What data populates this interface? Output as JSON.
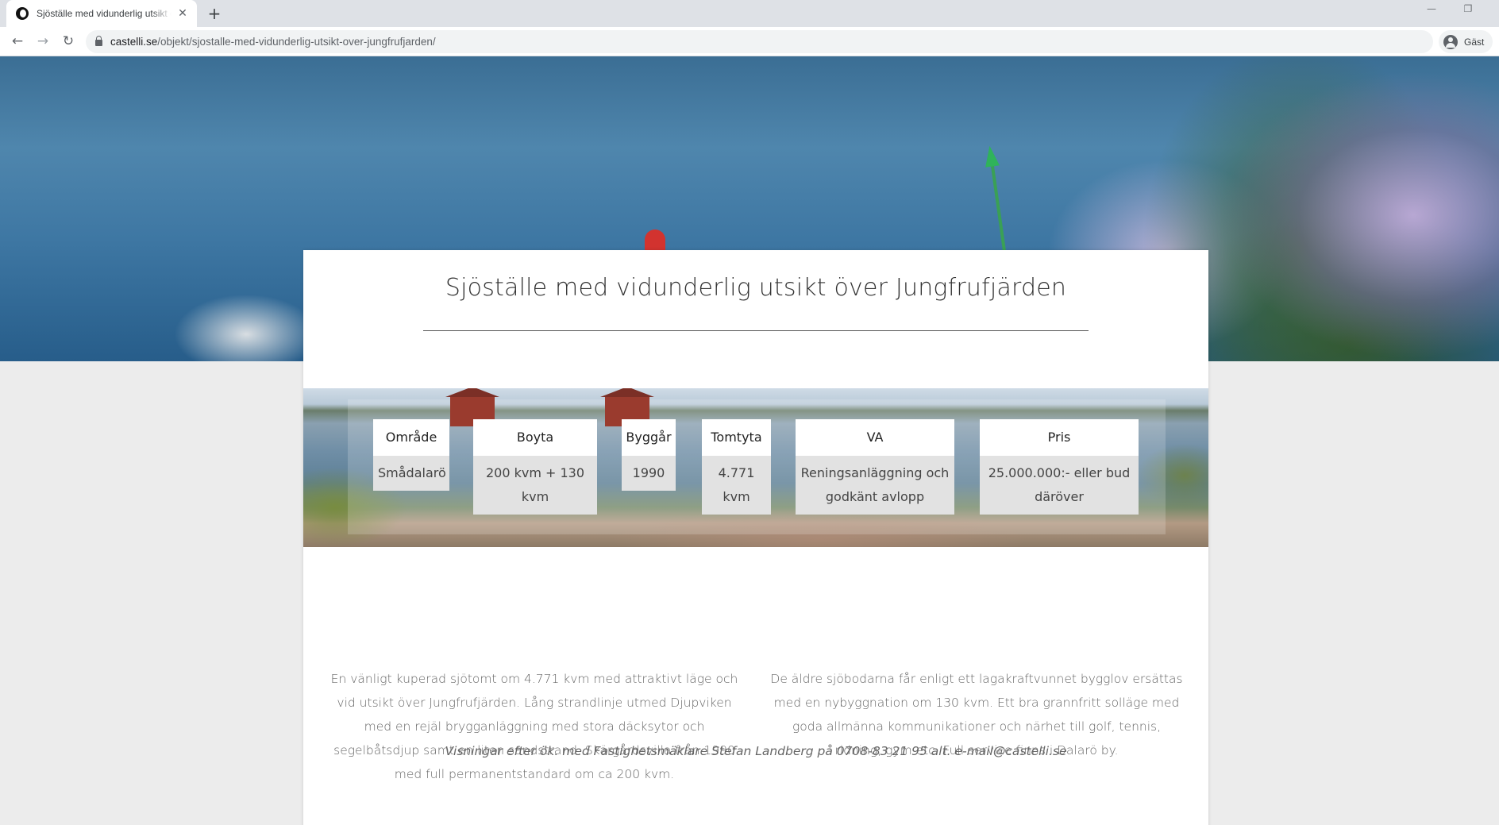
{
  "browser": {
    "tab_title": "Sjöställe med vidunderlig utsikt över Jungfrufjärden",
    "new_tab_glyph": "+",
    "close_glyph": "✕",
    "url_domain": "castelli.se",
    "url_path": "/objekt/sjostalle-med-vidunderlig-utsikt-over-jungfrufjarden/",
    "profile_label": "Gäst",
    "icons": [
      "back-icon",
      "forward-icon",
      "reload-icon",
      "lock-icon",
      "profile-icon",
      "minimize-icon",
      "restore-icon"
    ]
  },
  "page": {
    "title": "Sjöställe med vidunderlig utsikt över Jungfrufjärden",
    "facts": [
      {
        "label": "Område",
        "value": "Smådalarö"
      },
      {
        "label": "Boyta",
        "value": "200 kvm + 130 kvm"
      },
      {
        "label": "Byggår",
        "value": "1990"
      },
      {
        "label": "Tomtyta",
        "value": "4.771 kvm"
      },
      {
        "label": "VA",
        "value": "Reningsanläggning och godkänt avlopp"
      },
      {
        "label": "Pris",
        "value": "25.000.000:- eller bud däröver"
      }
    ],
    "description_left": "En vänligt kuperad sjötomt om 4.771 kvm med attraktivt läge och vid utsikt över Jungfrufjärden. Lång strandlinje utmed Djupviken med en rejäl brygganläggning med stora däcksytor och segelbåtsdjup samt en liten sandstrand. Skärgårdsvilla från 1990 med full permanentstandard om ca 200 kvm.",
    "description_right": "De äldre sjöbodarna får enligt ett lagakraftvunnet bygglov ersättas med en nybyggnation om 130 kvm. Ett bra grannfritt solläge med goda allmänna kommunikationer och närhet till golf, tennis, ridning, gym etc. Full service finns i Dalarö by.",
    "contact": "Visningar efter ök. med Fastighetsmäklare Stefan Landberg på 0708-83 21 95 alt. e-mail@castelli.se"
  }
}
